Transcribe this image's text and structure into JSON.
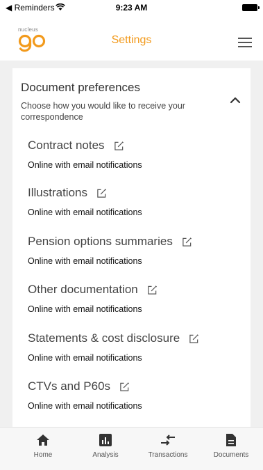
{
  "status_bar": {
    "back_label": "◀ Reminders",
    "time": "9:23 AM"
  },
  "header": {
    "logo_small": "nucleus",
    "title": "Settings"
  },
  "preferences": {
    "title": "Document preferences",
    "description": "Choose how you would like to receive your correspondence",
    "items": [
      {
        "label": "Contract notes",
        "value": "Online with email notifications"
      },
      {
        "label": "Illustrations",
        "value": "Online with email notifications"
      },
      {
        "label": "Pension options summaries",
        "value": "Online with email notifications"
      },
      {
        "label": "Other documentation",
        "value": "Online with email notifications"
      },
      {
        "label": "Statements & cost disclosure",
        "value": "Online with email notifications"
      },
      {
        "label": "CTVs and P60s",
        "value": "Online with email notifications"
      }
    ]
  },
  "tabs": [
    {
      "label": "Home",
      "icon": "home-icon"
    },
    {
      "label": "Analysis",
      "icon": "analysis-icon"
    },
    {
      "label": "Transactions",
      "icon": "transactions-icon"
    },
    {
      "label": "Documents",
      "icon": "documents-icon"
    }
  ],
  "colors": {
    "brand": "#f29a1c",
    "background": "#f0f0f0",
    "card": "#ffffff"
  }
}
